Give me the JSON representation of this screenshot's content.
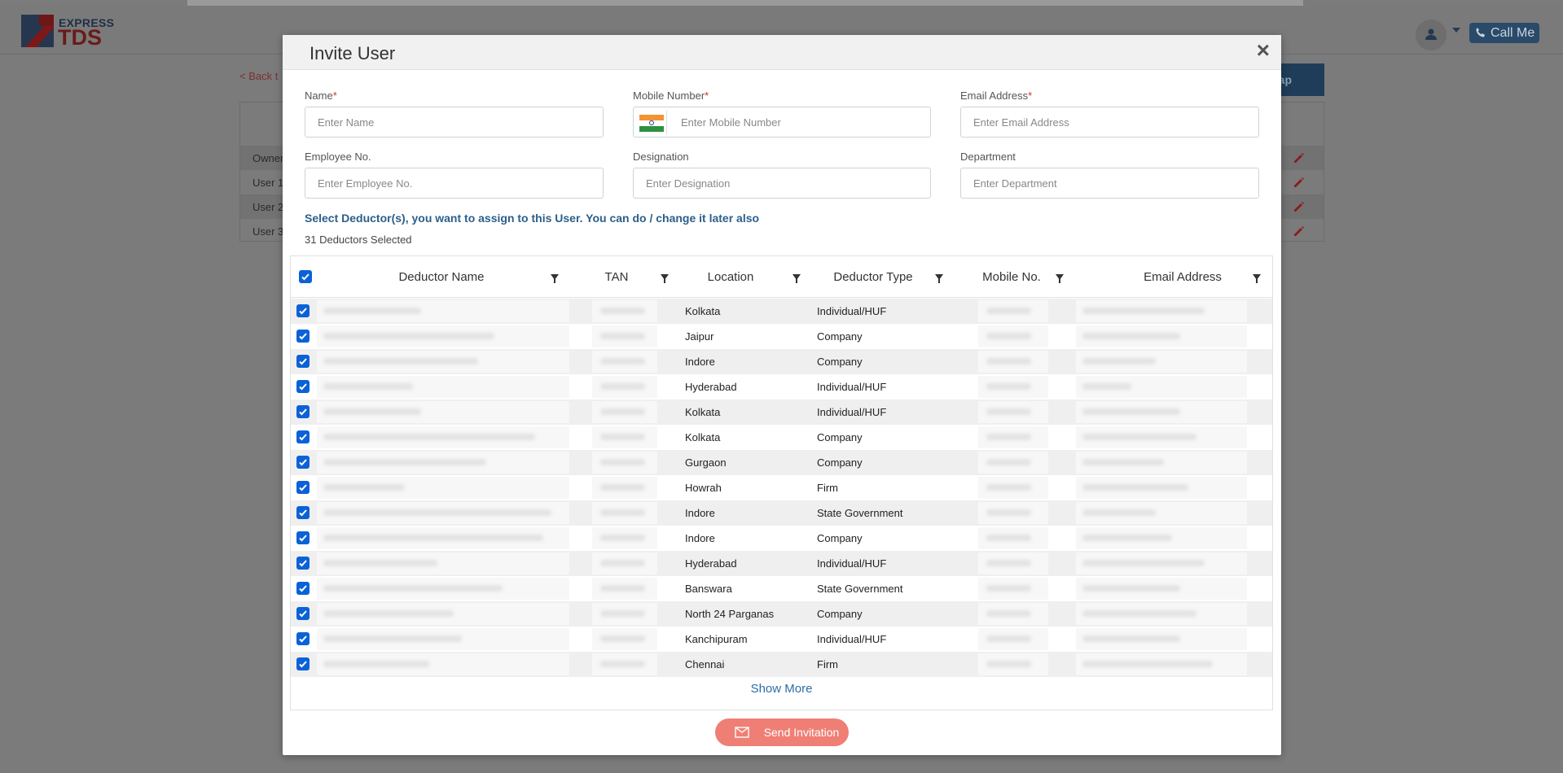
{
  "header": {
    "logo_top": "EXPRESS",
    "logo_bottom": "TDS",
    "call_label": "Call Me"
  },
  "background": {
    "back_link": "< Back t",
    "action_btn": "ap",
    "rows": [
      "Owner",
      "User 1",
      "User 2",
      "User 3"
    ]
  },
  "modal": {
    "title": "Invite User",
    "close_label": "×",
    "fields": {
      "name": {
        "label": "Name",
        "required": "*",
        "placeholder": "Enter Name"
      },
      "mobile": {
        "label": "Mobile Number",
        "required": "*",
        "placeholder": "Enter Mobile Number"
      },
      "email": {
        "label": "Email Address",
        "required": "*",
        "placeholder": "Enter Email Address"
      },
      "employee": {
        "label": "Employee No.",
        "placeholder": "Enter Employee No."
      },
      "designation": {
        "label": "Designation",
        "placeholder": "Enter Designation"
      },
      "department": {
        "label": "Department",
        "placeholder": "Enter Department"
      }
    },
    "instruction": "Select Deductor(s), you want to assign to this User. You can do / change it later also",
    "selected_count": "31 Deductors Selected",
    "columns": [
      "Deductor Name",
      "TAN",
      "Location",
      "Deductor Type",
      "Mobile No.",
      "Email Address"
    ],
    "rows": [
      {
        "location": "Kolkata",
        "type": "Individual/HUF"
      },
      {
        "location": "Jaipur",
        "type": "Company"
      },
      {
        "location": "Indore",
        "type": "Company"
      },
      {
        "location": "Hyderabad",
        "type": "Individual/HUF"
      },
      {
        "location": "Kolkata",
        "type": "Individual/HUF"
      },
      {
        "location": "Kolkata",
        "type": "Company"
      },
      {
        "location": "Gurgaon",
        "type": "Company"
      },
      {
        "location": "Howrah",
        "type": "Firm"
      },
      {
        "location": "Indore",
        "type": "State Government"
      },
      {
        "location": "Indore",
        "type": "Company"
      },
      {
        "location": "Hyderabad",
        "type": "Individual/HUF"
      },
      {
        "location": "Banswara",
        "type": "State Government"
      },
      {
        "location": "North 24 Parganas",
        "type": "Company"
      },
      {
        "location": "Kanchipuram",
        "type": "Individual/HUF"
      },
      {
        "location": "Chennai",
        "type": "Firm"
      }
    ],
    "show_more": "Show More",
    "send_label": "Send Invitation"
  }
}
